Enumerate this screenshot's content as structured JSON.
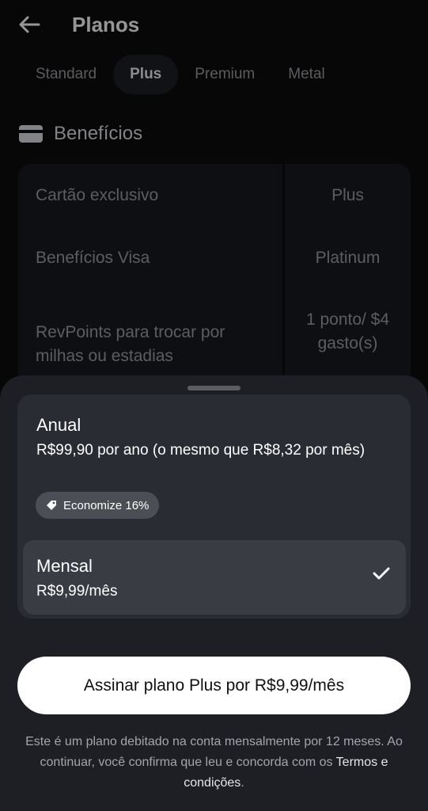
{
  "header": {
    "title": "Planos"
  },
  "tabs": [
    {
      "label": "Standard"
    },
    {
      "label": "Plus"
    },
    {
      "label": "Premium"
    },
    {
      "label": "Metal"
    }
  ],
  "active_tab": "Plus",
  "benefits": {
    "title": "Benefícios",
    "rows": [
      {
        "feature": "Cartão exclusivo",
        "value": "Plus"
      },
      {
        "feature": "Benefícios Visa",
        "value": "Platinum"
      },
      {
        "feature": "RevPoints para trocar por milhas ou estadias",
        "value": "1 ponto/ $4 gasto(s)"
      }
    ]
  },
  "sheet": {
    "annual": {
      "title": "Anual",
      "price": "R$99,90 por ano (o mesmo que R$8,32 por mês)",
      "badge": "Economize 16%"
    },
    "monthly": {
      "title": "Mensal",
      "price": "R$9,99/mês",
      "selected": true
    },
    "cta_label": "Assinar plano Plus por R$9,99/mês",
    "legal_text": "Este é um plano debitado na conta mensalmente por 12 meses. Ao continuar, você confirma que leu e concorda com os",
    "legal_link": "Termos e condições",
    "legal_end": "."
  },
  "colors": {
    "background": "#0b0b0d",
    "sheet": "#1d1f25",
    "cta": "#ffffff"
  },
  "icons": [
    "arrow-left-icon",
    "card-icon",
    "tag-icon",
    "checkmark-icon"
  ]
}
